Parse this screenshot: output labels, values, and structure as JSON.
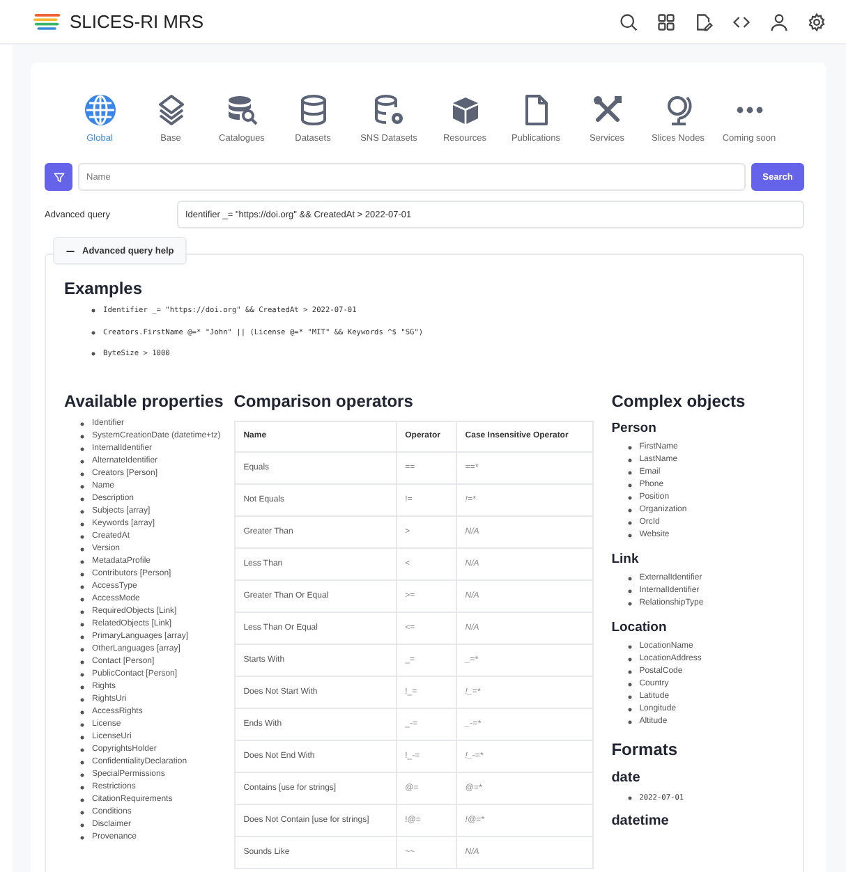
{
  "app": {
    "title": "SLICES-RI MRS"
  },
  "categories": [
    {
      "label": "Global",
      "kind": "globe",
      "selected": true
    },
    {
      "label": "Base",
      "kind": "layers",
      "selected": false
    },
    {
      "label": "Catalogues",
      "kind": "db-search",
      "selected": false
    },
    {
      "label": "Datasets",
      "kind": "database",
      "selected": false
    },
    {
      "label": "SNS Datasets",
      "kind": "db-gear",
      "selected": false
    },
    {
      "label": "Resources",
      "kind": "box",
      "selected": false
    },
    {
      "label": "Publications",
      "kind": "file",
      "selected": false
    },
    {
      "label": "Services",
      "kind": "tools",
      "selected": false
    },
    {
      "label": "Slices Nodes",
      "kind": "globe-stand",
      "selected": false
    },
    {
      "label": "Coming soon",
      "kind": "dots",
      "selected": false
    }
  ],
  "search": {
    "placeholder": "Name",
    "button": "Search"
  },
  "advanced_query": {
    "label": "Advanced query",
    "value": "Identifier _= \"https://doi.org\" && CreatedAt > 2022-07-01"
  },
  "help": {
    "toggle": "Advanced query help",
    "expanded": true,
    "examples_title": "Examples",
    "examples": [
      "Identifier _= \"https://doi.org\" && CreatedAt > 2022-07-01",
      "Creators.FirstName @=* \"John\" || (License @=* \"MIT\" && Keywords ^$ \"SG\")",
      "ByteSize > 1000"
    ],
    "properties_title": "Available properties",
    "properties": [
      "Identifier",
      "SystemCreationDate (datetime+tz)",
      "InternalIdentifier",
      "AlternateIdentifier",
      "Creators [Person]",
      "Name",
      "Description",
      "Subjects [array]",
      "Keywords [array]",
      "CreatedAt",
      "Version",
      "MetadataProfile",
      "Contributors [Person]",
      "AccessType",
      "AccessMode",
      "RequiredObjects [Link]",
      "RelatedObjects [Link]",
      "PrimaryLanguages [array]",
      "OtherLanguages [array]",
      "Contact [Person]",
      "PublicContact [Person]",
      "Rights",
      "RightsUri",
      "AccessRights",
      "License",
      "LicenseUri",
      "CopyrightsHolder",
      "ConfidentialityDeclaration",
      "SpecialPermissions",
      "Restrictions",
      "CitationRequirements",
      "Conditions",
      "Disclaimer",
      "Provenance"
    ],
    "operators_title": "Comparison operators",
    "operators_table": {
      "columns": [
        "Name",
        "Operator",
        "Case Insensitive Operator"
      ],
      "rows": [
        [
          "Equals",
          "==",
          "==*"
        ],
        [
          "Not Equals",
          "!=",
          "!=*"
        ],
        [
          "Greater Than",
          ">",
          "N/A"
        ],
        [
          "Less Than",
          "<",
          "N/A"
        ],
        [
          "Greater Than Or Equal",
          ">=",
          "N/A"
        ],
        [
          "Less Than Or Equal",
          "<=",
          "N/A"
        ],
        [
          "Starts With",
          "_=",
          "_=*"
        ],
        [
          "Does Not Start With",
          "!_=",
          "!_=*"
        ],
        [
          "Ends With",
          "_-=",
          "_-=*"
        ],
        [
          "Does Not End With",
          "!_-=",
          "!_-=*"
        ],
        [
          "Contains [use for strings]",
          "@=",
          "@=*"
        ],
        [
          "Does Not Contain [use for strings]",
          "!@=",
          "!@=*"
        ],
        [
          "Sounds Like",
          "~~",
          "N/A"
        ]
      ]
    },
    "complex_title": "Complex objects",
    "complex_objects": [
      {
        "name": "Person",
        "fields": [
          "FirstName",
          "LastName",
          "Email",
          "Phone",
          "Position",
          "Organization",
          "OrcId",
          "Website"
        ]
      },
      {
        "name": "Link",
        "fields": [
          "ExternalIdentifier",
          "InternalIdentifier",
          "RelationshipType"
        ]
      },
      {
        "name": "Location",
        "fields": [
          "LocationName",
          "LocationAddress",
          "PostalCode",
          "Country",
          "Latitude",
          "Longitude",
          "Altitude"
        ]
      }
    ],
    "formats_title": "Formats",
    "formats": [
      {
        "name": "date",
        "examples": [
          "2022-07-01"
        ]
      },
      {
        "name": "datetime"
      }
    ]
  }
}
